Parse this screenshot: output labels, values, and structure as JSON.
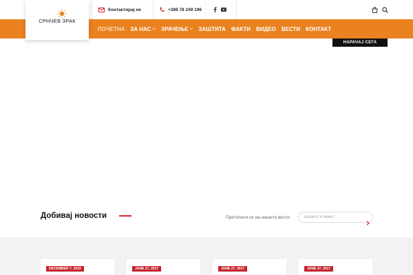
{
  "header": {
    "brand": "СРНЧЕВ ЗРАК",
    "contact_label": "Контактирај не",
    "phone": "+389 78 249 196",
    "social": [
      {
        "icon": "facebook-icon"
      },
      {
        "icon": "youtube-icon"
      }
    ],
    "icons": [
      "cart-icon",
      "search-icon"
    ]
  },
  "nav": {
    "items": [
      {
        "label": "ПОЧЕТНА",
        "active": true,
        "dropdown": false
      },
      {
        "label": "ЗА НАС",
        "active": false,
        "dropdown": true
      },
      {
        "label": "ЗРАЧЕЊЕ",
        "active": false,
        "dropdown": true
      },
      {
        "label": "ЗАШТИТА",
        "active": false,
        "dropdown": false
      },
      {
        "label": "ФАКТИ",
        "active": false,
        "dropdown": false
      },
      {
        "label": "ВИДЕО",
        "active": false,
        "dropdown": false
      },
      {
        "label": "ВЕСТИ",
        "active": false,
        "dropdown": false
      },
      {
        "label": "КОНТАКТ",
        "active": false,
        "dropdown": false
      }
    ],
    "order_button": "НАРАЧАЈ СЕГА"
  },
  "newsletter": {
    "title": "Добивај новости",
    "subtitle": "Претплати се на нашите вести",
    "email_placeholder": "Вашиот е-маил"
  },
  "posts": [
    {
      "date": "DECEMBER 7, 2019"
    },
    {
      "date": "JUNE 27, 2017"
    },
    {
      "date": "JUNE 27, 2017"
    },
    {
      "date": "JUNE 27, 2017"
    }
  ],
  "colors": {
    "accent_orange": "#e9821f",
    "accent_red": "#c4232a",
    "dark": "#111111"
  }
}
